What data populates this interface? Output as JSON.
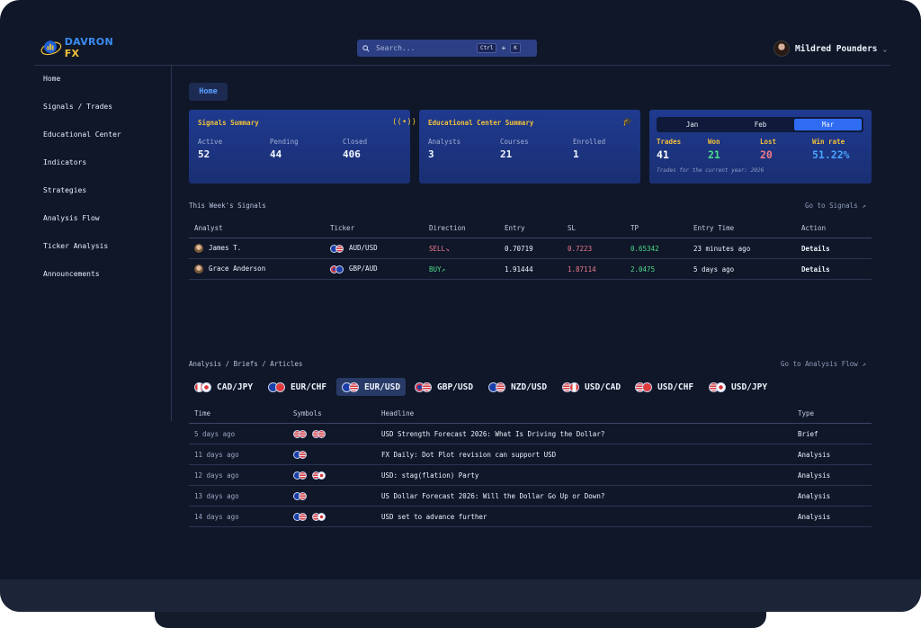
{
  "brand": {
    "part1": "DAVRON",
    "part2": " FX"
  },
  "search": {
    "placeholder": "Search...",
    "key1": "Ctrl",
    "plus": "+",
    "key2": "K"
  },
  "user": {
    "name": "Mildred Pounders"
  },
  "nav": [
    "Home",
    "Signals / Trades",
    "Educational Center",
    "Indicators",
    "Strategies",
    "Analysis Flow",
    "Ticker Analysis",
    "Announcements"
  ],
  "breadcrumb": "Home",
  "signals_summary": {
    "title": "Signals Summary",
    "stats": [
      {
        "label": "Active",
        "value": "52"
      },
      {
        "label": "Pending",
        "value": "44"
      },
      {
        "label": "Closed",
        "value": "406"
      }
    ]
  },
  "edu_summary": {
    "title": "Educational Center Summary",
    "stats": [
      {
        "label": "Analysts",
        "value": "3"
      },
      {
        "label": "Courses",
        "value": "21"
      },
      {
        "label": "Enrolled",
        "value": "1"
      }
    ]
  },
  "month_card": {
    "months": [
      "Jan",
      "Feb",
      "Mar"
    ],
    "active_month": "Mar",
    "stats": [
      {
        "label": "Trades",
        "value": "41",
        "color": "#ffffff"
      },
      {
        "label": "Won",
        "value": "21",
        "color": "#4fdc8a"
      },
      {
        "label": "Lost",
        "value": "20",
        "color": "#f07a8a"
      },
      {
        "label": "Win rate",
        "value": "51.22%",
        "color": "#4aa3ff"
      }
    ],
    "label_color": "#f2c13a",
    "note": "Trades for the current year: 2026"
  },
  "weekly_signals": {
    "title": "This Week's Signals",
    "link": "Go to Signals",
    "columns": [
      "Analyst",
      "Ticker",
      "Direction",
      "Entry",
      "SL",
      "TP",
      "Entry Time",
      "Action"
    ],
    "rows": [
      {
        "analyst": "James T.",
        "ticker": "AUD/USD",
        "direction": "SELL",
        "entry": "0.70719",
        "sl": "0.7223",
        "tp": "0.65342",
        "time": "23 minutes ago",
        "action": "Details"
      },
      {
        "analyst": "Grace Anderson",
        "ticker": "GBP/AUD",
        "direction": "BUY",
        "entry": "1.91444",
        "sl": "1.87114",
        "tp": "2.0475",
        "time": "5 days ago",
        "action": "Details"
      }
    ]
  },
  "analysis": {
    "title": "Analysis / Briefs / Articles",
    "link": "Go to Analysis Flow",
    "chips": [
      "CAD/JPY",
      "EUR/CHF",
      "EUR/USD",
      "GBP/USD",
      "NZD/USD",
      "USD/CAD",
      "USD/CHF",
      "USD/JPY"
    ],
    "active_chip": "EUR/USD",
    "columns": [
      "Time",
      "Symbols",
      "Headline",
      "Type"
    ],
    "rows": [
      {
        "time": "5 days ago",
        "headline": "USD Strength Forecast 2026: What Is Driving the Dollar?",
        "type": "Brief"
      },
      {
        "time": "11 days ago",
        "headline": "FX Daily: Dot Plot revision can support USD",
        "type": "Analysis"
      },
      {
        "time": "12 days ago",
        "headline": "USD: stag(flation) Party",
        "type": "Analysis"
      },
      {
        "time": "13 days ago",
        "headline": "US Dollar Forecast 2026: Will the Dollar Go Up or Down?",
        "type": "Analysis"
      },
      {
        "time": "14 days ago",
        "headline": "USD set to advance further",
        "type": "Analysis"
      }
    ]
  }
}
